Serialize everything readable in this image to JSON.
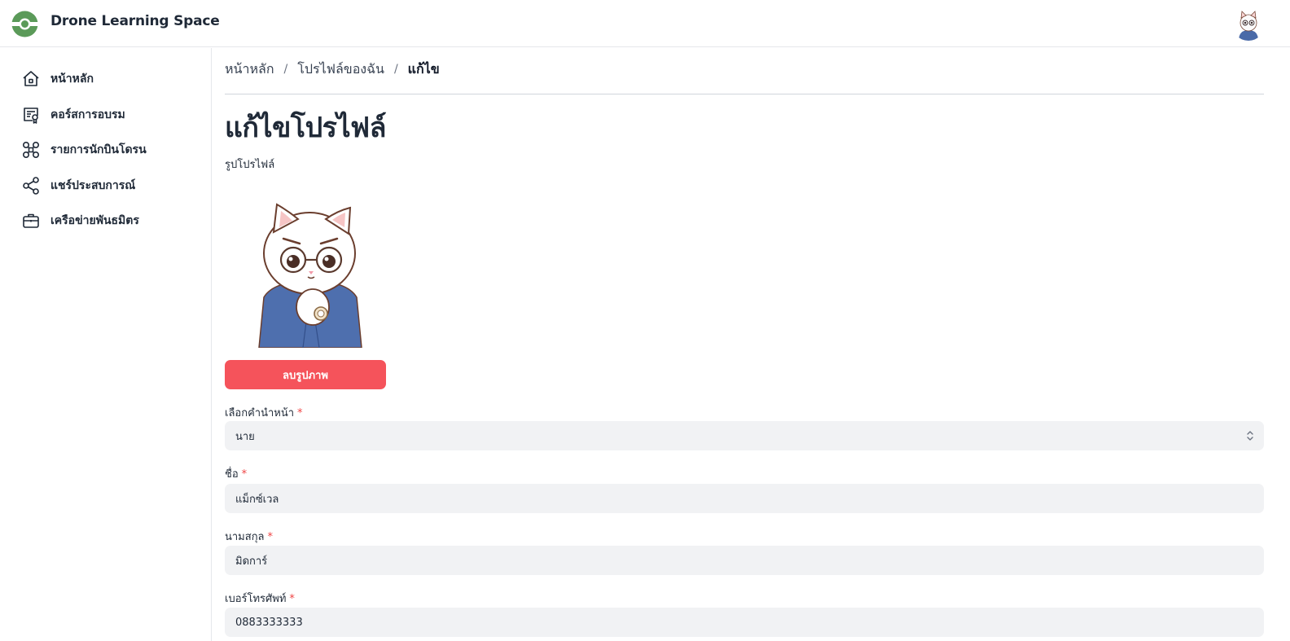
{
  "header": {
    "app_title": "Drone Learning Space",
    "brand_color": "#5b9a59",
    "logo_icon": "drone-eye-logo",
    "avatar_icon": "cat-avatar"
  },
  "sidebar": {
    "items": [
      {
        "label": "หน้าหลัก",
        "icon": "home-icon"
      },
      {
        "label": "คอร์สการอบรม",
        "icon": "certificate-icon"
      },
      {
        "label": "รายการนักบินโดรน",
        "icon": "drone-icon"
      },
      {
        "label": "แชร์ประสบการณ์",
        "icon": "share-icon"
      },
      {
        "label": "เครือข่ายพันธมิตร",
        "icon": "briefcase-icon"
      }
    ]
  },
  "breadcrumb": {
    "home": "หน้าหลัก",
    "profile": "โปรไฟล์ของฉัน",
    "current": "แก้ไข",
    "separator": "/"
  },
  "page": {
    "title": "แก้ไขโปรไฟล์",
    "profile_image_label": "รูปโปรไฟล์",
    "delete_image_label": "ลบรูปภาพ"
  },
  "form": {
    "required_mark": "*",
    "prefix": {
      "label": "เลือกคำนำหน้า",
      "value": "นาย"
    },
    "first_name": {
      "label": "ชื่อ",
      "value": "แม็กซ์เวล"
    },
    "last_name": {
      "label": "นามสกุล",
      "value": "มิดการ์"
    },
    "phone": {
      "label": "เบอร์โทรศัพท์",
      "value": "0883333333"
    }
  },
  "colors": {
    "danger_button": "#f5535b",
    "input_background": "#f1f2f4",
    "required": "#ef4444"
  }
}
